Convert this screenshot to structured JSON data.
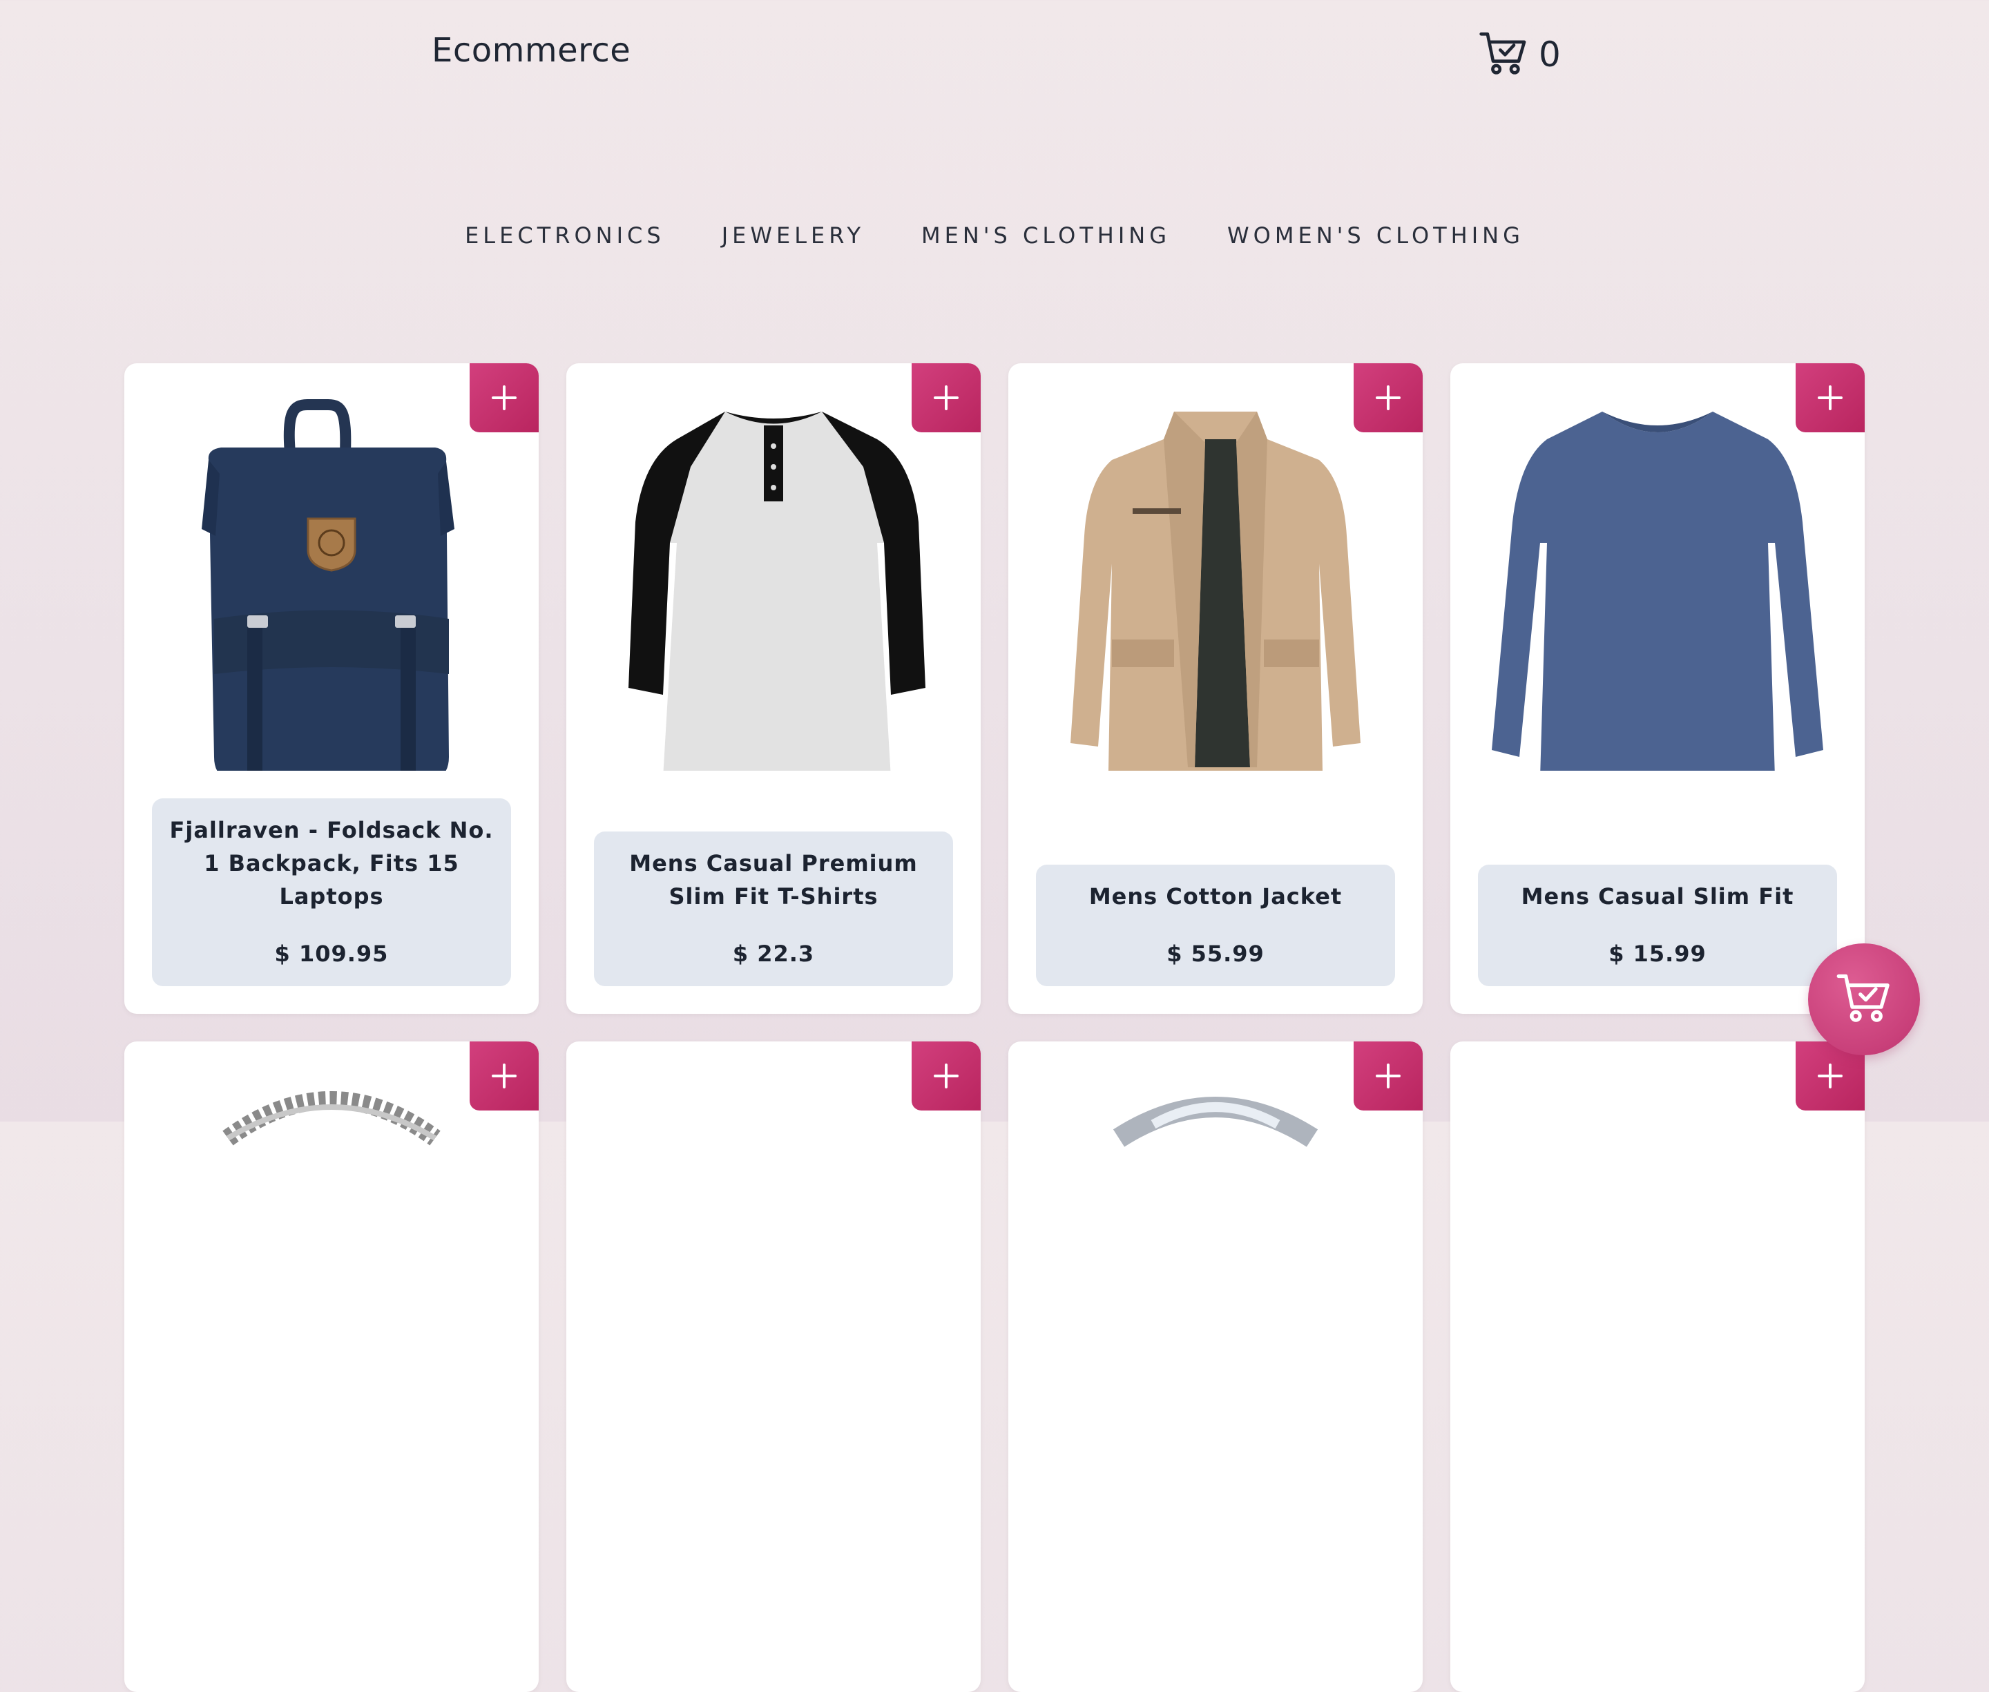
{
  "header": {
    "brand": "Ecommerce",
    "cart_icon": "shopping-cart-check-icon",
    "cart_count": "0"
  },
  "categories": [
    "ELECTRONICS",
    "JEWELERY",
    "MEN'S CLOTHING",
    "WOMEN'S CLOTHING"
  ],
  "products": [
    {
      "title": "Fjallraven - Foldsack No. 1 Backpack, Fits 15 Laptops",
      "price": "$ 109.95",
      "image": "backpack"
    },
    {
      "title": "Mens Casual Premium Slim Fit T-Shirts",
      "price": "$ 22.3",
      "image": "raglan-shirt"
    },
    {
      "title": "Mens Cotton Jacket",
      "price": "$ 55.99",
      "image": "jacket"
    },
    {
      "title": "Mens Casual Slim Fit",
      "price": "$ 15.99",
      "image": "long-sleeve-shirt"
    },
    {
      "title": "",
      "price": "",
      "image": "bracelet"
    },
    {
      "title": "",
      "price": "",
      "image": "blank"
    },
    {
      "title": "",
      "price": "",
      "image": "ring"
    },
    {
      "title": "",
      "price": "",
      "image": "blank"
    }
  ],
  "add_icon": "plus-icon",
  "floating_cart_icon": "shopping-cart-check-icon",
  "colors": {
    "accent": "#c2306a",
    "card_info_bg": "#e2e7ef",
    "page_bg": "#efe5e9"
  }
}
